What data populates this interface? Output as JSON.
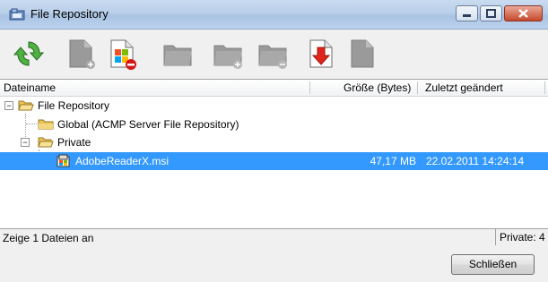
{
  "window": {
    "title": "File Repository"
  },
  "toolbar": {
    "buttons": [
      {
        "icon": "refresh-icon",
        "enabled": true
      },
      {
        "icon": "add-file-icon",
        "enabled": false
      },
      {
        "icon": "remove-file-icon",
        "enabled": true
      },
      {
        "icon": "folder-icon",
        "enabled": false
      },
      {
        "icon": "add-folder-icon",
        "enabled": false
      },
      {
        "icon": "remove-folder-icon",
        "enabled": false
      },
      {
        "icon": "download-icon",
        "enabled": true
      },
      {
        "icon": "file-icon",
        "enabled": false
      }
    ]
  },
  "columns": {
    "name": "Dateiname",
    "size": "Größe (Bytes)",
    "modified": "Zuletzt geändert"
  },
  "tree": {
    "root": "File Repository",
    "global": "Global (ACMP Server File Repository)",
    "private": "Private",
    "file": {
      "name": "AdobeReaderX.msi",
      "size": "47,17 MB",
      "modified": "22.02.2011 14:24:14"
    }
  },
  "status": {
    "text": "Zeige 1 Dateien an",
    "right": "Private: 4"
  },
  "buttons": {
    "close": "Schließen"
  },
  "colors": {
    "selection": "#3399ff",
    "title_bar": "#b9cfe9"
  }
}
